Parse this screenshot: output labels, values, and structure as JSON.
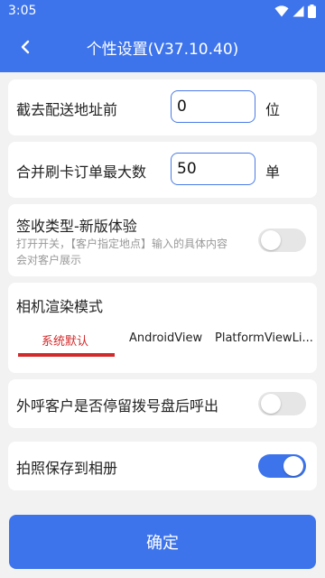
{
  "status_bar": {
    "time": "3:05"
  },
  "header": {
    "title": "个性设置(V37.10.40)"
  },
  "settings": {
    "trim_address": {
      "label": "截去配送地址前",
      "value": "0",
      "unit": "位"
    },
    "merge_orders": {
      "label": "合并刷卡订单最大数",
      "value": "50",
      "unit": "单"
    },
    "sign_type": {
      "label": "签收类型-新版体验",
      "description": "打开开关，【客户指定地点】输入的具体内容会对客户展示",
      "enabled": false
    },
    "camera_mode": {
      "label": "相机渲染模式",
      "tabs": [
        "系统默认",
        "AndroidView",
        "PlatformViewLi..."
      ],
      "selected_index": 0
    },
    "outbound_call": {
      "label": "外呼客户是否停留拨号盘后呼出",
      "enabled": false
    },
    "save_photo": {
      "label": "拍照保存到相册",
      "enabled": true
    }
  },
  "footer": {
    "confirm_label": "确定"
  },
  "colors": {
    "primary": "#3d74ec",
    "tab_active": "#d22a2a",
    "background": "#f2f2f2"
  },
  "icons": [
    "back-arrow-icon",
    "wifi-icon",
    "signal-icon",
    "battery-icon"
  ]
}
